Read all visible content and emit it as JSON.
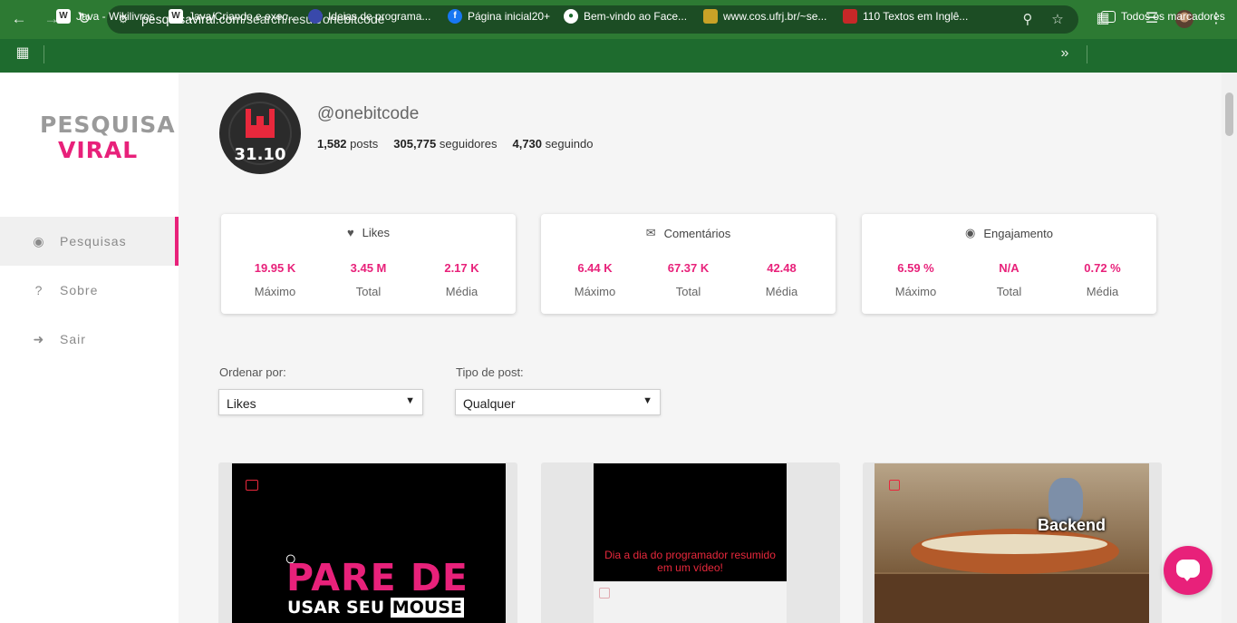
{
  "browser": {
    "url_domain": "pesquisaviral.com",
    "url_path": "/search/result/onebitcode",
    "bookmarks": [
      {
        "label": "Java - Wikilivros",
        "icon": "wikibooks-icon",
        "color": "#ffffff"
      },
      {
        "label": "Java/Criando e exec...",
        "icon": "wikibooks-icon",
        "color": "#ffffff"
      },
      {
        "label": "Ideias de programa...",
        "icon": "site-icon",
        "color": "#3949ab"
      },
      {
        "label": "Página inicial20+",
        "icon": "facebook-icon",
        "color": "#1877f2"
      },
      {
        "label": "Bem-vindo ao Face...",
        "icon": "globe-icon",
        "color": "#ffffff"
      },
      {
        "label": "www.cos.ufrj.br/~se...",
        "icon": "site-icon",
        "color": "#c9a227"
      },
      {
        "label": "110 Textos em Inglê...",
        "icon": "site-icon",
        "color": "#c62828"
      }
    ],
    "all_bookmarks_label": "Todos os marcadores"
  },
  "sidebar": {
    "logo_line1": "PESQUISA",
    "logo_line2": "VIRAL",
    "items": [
      {
        "label": "Pesquisas",
        "icon": "users-icon",
        "active": true
      },
      {
        "label": "Sobre",
        "icon": "question-circle-icon",
        "active": false
      },
      {
        "label": "Sair",
        "icon": "sign-out-icon",
        "active": false
      }
    ]
  },
  "profile": {
    "avatar_text": "31.10",
    "handle": "@onebitcode",
    "posts_count": "1,582",
    "posts_label": "posts",
    "followers_count": "305,775",
    "followers_label": "seguidores",
    "following_count": "4,730",
    "following_label": "seguindo"
  },
  "cards": [
    {
      "title": "Likes",
      "icon": "heart-icon",
      "metrics": [
        {
          "value": "19.95 K",
          "label": "Máximo"
        },
        {
          "value": "3.45 M",
          "label": "Total"
        },
        {
          "value": "2.17 K",
          "label": "Média"
        }
      ]
    },
    {
      "title": "Comentários",
      "icon": "comments-icon",
      "metrics": [
        {
          "value": "6.44 K",
          "label": "Máximo"
        },
        {
          "value": "67.37 K",
          "label": "Total"
        },
        {
          "value": "42.48",
          "label": "Média"
        }
      ]
    },
    {
      "title": "Engajamento",
      "icon": "users-icon",
      "metrics": [
        {
          "value": "6.59 %",
          "label": "Máximo"
        },
        {
          "value": "N/A",
          "label": "Total"
        },
        {
          "value": "0.72 %",
          "label": "Média"
        }
      ]
    }
  ],
  "filters": {
    "sort_label": "Ordenar por:",
    "sort_value": "Likes",
    "type_label": "Tipo de post:",
    "type_value": "Qualquer"
  },
  "posts": [
    {
      "line1": "PARE DE",
      "line2a": "USAR SEU",
      "line2b": "MOUSE"
    },
    {
      "caption": "Dia a dia do programador resumido em um vídeo!"
    },
    {
      "caption": "Backend"
    }
  ],
  "colors": {
    "accent": "#e8217a",
    "chrome": "#1e6b2e"
  }
}
